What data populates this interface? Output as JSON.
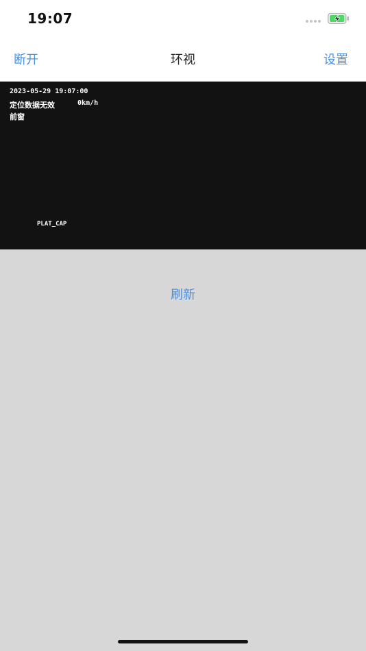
{
  "status_bar": {
    "time": "19:07"
  },
  "nav": {
    "left_label": "断开",
    "title": "环视",
    "right_label": "设置"
  },
  "video": {
    "timestamp": "2023-05-29 19:07:00",
    "gps_status": "定位数据无效",
    "speed": "0km/h",
    "camera": "前窗",
    "plate": "PLAT_CAP"
  },
  "actions": {
    "refresh_label": "刷新"
  },
  "colors": {
    "accent": "#4a90e2",
    "video_bg": "#121212",
    "page_bg": "#d7d7d7",
    "battery_fill": "#4cd964"
  }
}
